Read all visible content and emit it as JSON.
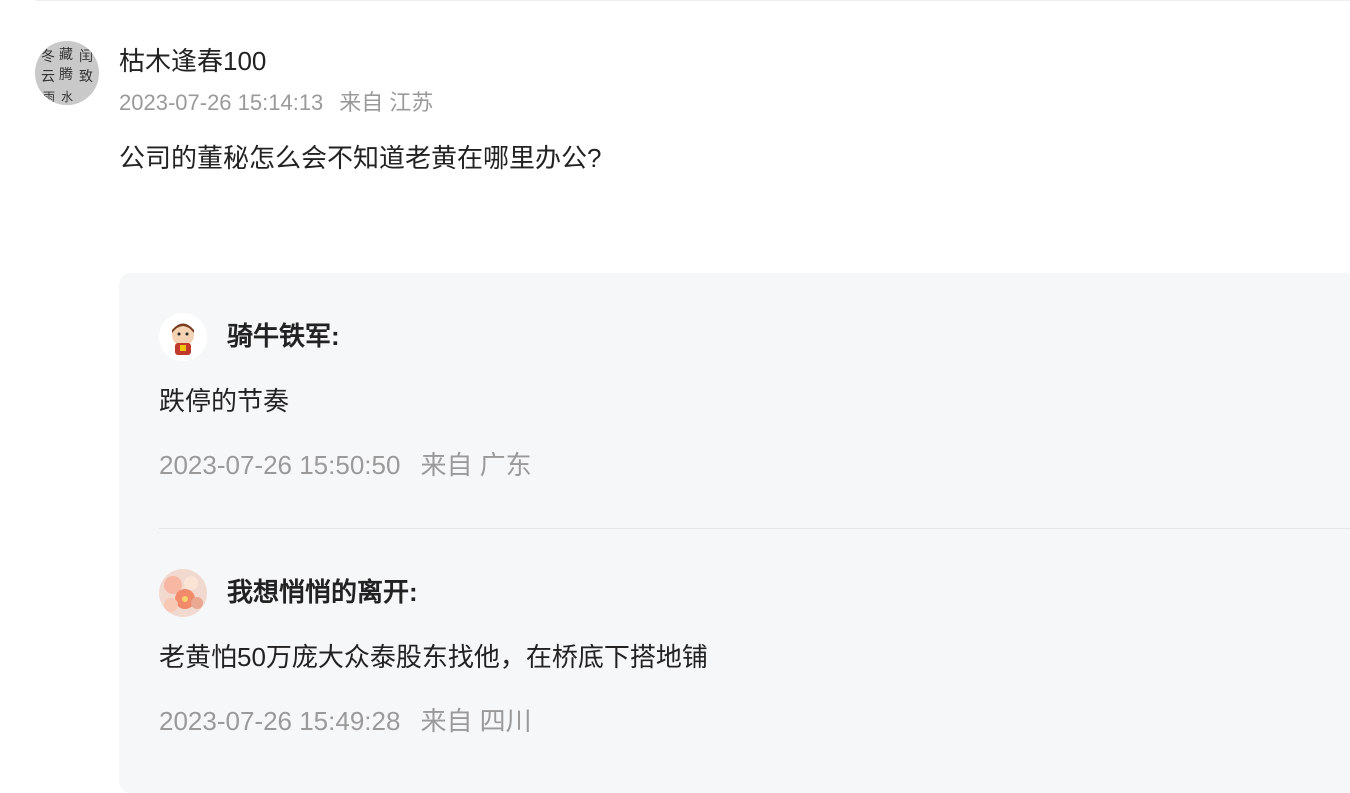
{
  "comment": {
    "username": "枯木逢春100",
    "timestamp": "2023-07-26 15:14:13",
    "location": "来自 江苏",
    "avatar_icon": "calligraphy-avatar",
    "text": "公司的董秘怎么会不知道老黄在哪里办公?"
  },
  "replies": [
    {
      "username": "骑牛铁军:",
      "avatar_icon": "cartoon-character-avatar",
      "text": "跌停的节奏",
      "timestamp": "2023-07-26 15:50:50",
      "location": "来自 广东"
    },
    {
      "username": "我想悄悄的离开:",
      "avatar_icon": "flower-photo-avatar",
      "text": "老黄怕50万庞大众泰股东找他，在桥底下搭地铺",
      "timestamp": "2023-07-26 15:49:28",
      "location": "来自 四川"
    }
  ],
  "colors": {
    "text": "#222222",
    "meta": "#9a9a9a",
    "reply_background": "#f6f7f9",
    "divider": "#e6e6e6"
  }
}
